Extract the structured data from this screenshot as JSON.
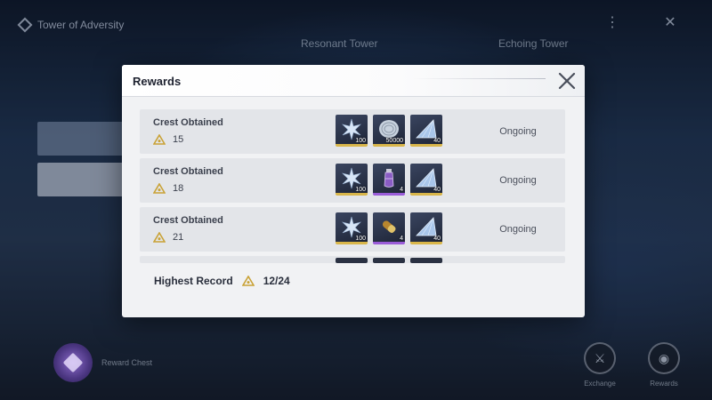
{
  "background": {
    "window_title": "Tower of Adversity",
    "tabs": [
      "Resonant Tower",
      "Echoing Tower"
    ],
    "bottom_left_label": "Reward Chest",
    "bottom_buttons": [
      "Exchange",
      "Rewards"
    ]
  },
  "modal": {
    "title": "Rewards",
    "rows": [
      {
        "title": "Crest Obtained",
        "crest_count": "15",
        "status": "Ongoing",
        "items": [
          {
            "icon": "star-crystal-icon",
            "qty": "100",
            "rarity": "gold"
          },
          {
            "icon": "shell-credit-icon",
            "qty": "50000",
            "rarity": "gold"
          },
          {
            "icon": "prism-shard-icon",
            "qty": "40",
            "rarity": "gold"
          }
        ]
      },
      {
        "title": "Crest Obtained",
        "crest_count": "18",
        "status": "Ongoing",
        "items": [
          {
            "icon": "star-crystal-icon",
            "qty": "100",
            "rarity": "gold"
          },
          {
            "icon": "potion-vial-icon",
            "qty": "4",
            "rarity": "purple"
          },
          {
            "icon": "prism-shard-icon",
            "qty": "40",
            "rarity": "gold"
          }
        ]
      },
      {
        "title": "Crest Obtained",
        "crest_count": "21",
        "status": "Ongoing",
        "items": [
          {
            "icon": "star-crystal-icon",
            "qty": "100",
            "rarity": "gold"
          },
          {
            "icon": "capsule-icon",
            "qty": "4",
            "rarity": "purple"
          },
          {
            "icon": "prism-shard-icon",
            "qty": "40",
            "rarity": "gold"
          }
        ]
      }
    ],
    "footer": {
      "label": "Highest Record",
      "value": "12/24"
    }
  },
  "colors": {
    "gold_rarity": "#d9b64a",
    "purple_rarity": "#9a5cd8",
    "crest_icon": "#c9a236"
  }
}
